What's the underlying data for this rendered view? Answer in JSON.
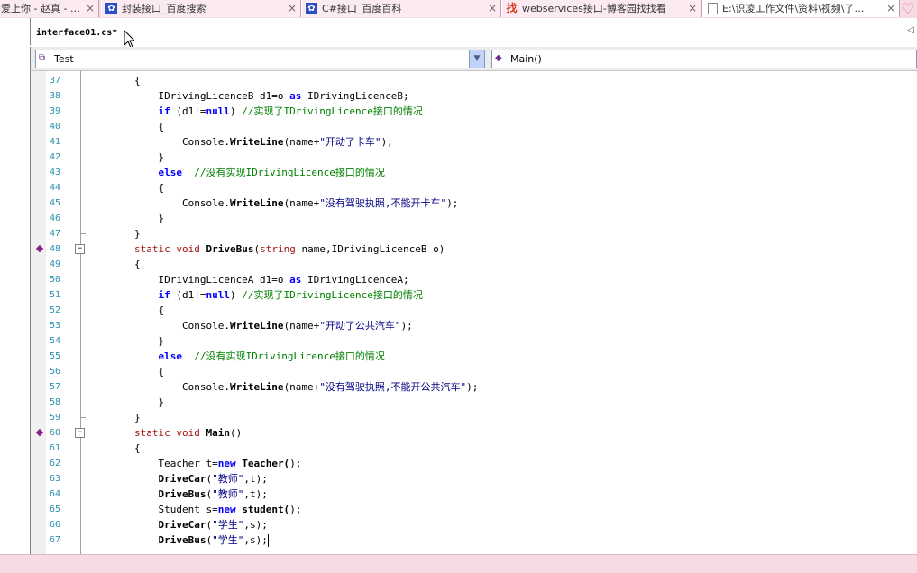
{
  "browser_tabs": [
    {
      "label": "爱上你 - 赵真 - …",
      "icon": "music-icon",
      "close": "×",
      "active": false
    },
    {
      "label": "封装接口_百度搜索",
      "icon": "baidu-paw-icon",
      "close": "×",
      "active": false
    },
    {
      "label": "C#接口_百度百科",
      "icon": "baidu-paw-icon",
      "close": "×",
      "active": false
    },
    {
      "label": "webservices接口-博客园找找看",
      "icon": "cnblogs-icon",
      "icon_text": "找",
      "close": "×",
      "active": false
    },
    {
      "label": "E:\\识凌工作文件\\资料\\视频\\了…",
      "icon": "document-icon",
      "close": "×",
      "active": true
    }
  ],
  "editor_tab": {
    "label": "interface01.cs*"
  },
  "nav": {
    "class_select": "Test",
    "member_select": "Main()"
  },
  "colors": {
    "tab_strip": "#f7dbe4",
    "keyword": "#0000ff",
    "comment": "#008000",
    "line_number": "#2b91af"
  },
  "code_lines": [
    {
      "n": "37",
      "text": "        {"
    },
    {
      "n": "38",
      "text": "            IDrivingLicenceB d1=o as IDrivingLicenceB;"
    },
    {
      "n": "39",
      "text": "            if (d1!=null) //实现了IDrivingLicence接口的情况"
    },
    {
      "n": "40",
      "text": "            {"
    },
    {
      "n": "41",
      "text": "                Console.WriteLine(name+\"开动了卡车\");"
    },
    {
      "n": "42",
      "text": "            }"
    },
    {
      "n": "43",
      "text": "            else  //没有实现IDrivingLicence接口的情况"
    },
    {
      "n": "44",
      "text": "            {"
    },
    {
      "n": "45",
      "text": "                Console.WriteLine(name+\"没有驾驶执照,不能开卡车\");"
    },
    {
      "n": "46",
      "text": "            }"
    },
    {
      "n": "47",
      "text": "        }"
    },
    {
      "n": "48",
      "text": "        static void DriveBus(string name,IDrivingLicenceB o)"
    },
    {
      "n": "49",
      "text": "        {"
    },
    {
      "n": "50",
      "text": "            IDrivingLicenceA d1=o as IDrivingLicenceA;"
    },
    {
      "n": "51",
      "text": "            if (d1!=null) //实现了IDrivingLicence接口的情况"
    },
    {
      "n": "52",
      "text": "            {"
    },
    {
      "n": "53",
      "text": "                Console.WriteLine(name+\"开动了公共汽车\");"
    },
    {
      "n": "54",
      "text": "            }"
    },
    {
      "n": "55",
      "text": "            else  //没有实现IDrivingLicence接口的情况"
    },
    {
      "n": "56",
      "text": "            {"
    },
    {
      "n": "57",
      "text": "                Console.WriteLine(name+\"没有驾驶执照,不能开公共汽车\");"
    },
    {
      "n": "58",
      "text": "            }"
    },
    {
      "n": "59",
      "text": "        }"
    },
    {
      "n": "60",
      "text": "        static void Main()"
    },
    {
      "n": "61",
      "text": "        {"
    },
    {
      "n": "62",
      "text": "            Teacher t=new Teacher();"
    },
    {
      "n": "63",
      "text": "            DriveCar(\"教师\",t);"
    },
    {
      "n": "64",
      "text": "            DriveBus(\"教师\",t);"
    },
    {
      "n": "65",
      "text": "            Student s=new student();"
    },
    {
      "n": "66",
      "text": "            DriveCar(\"学生\",s);"
    },
    {
      "n": "67",
      "text": "            DriveBus(\"学生\",s);"
    }
  ]
}
